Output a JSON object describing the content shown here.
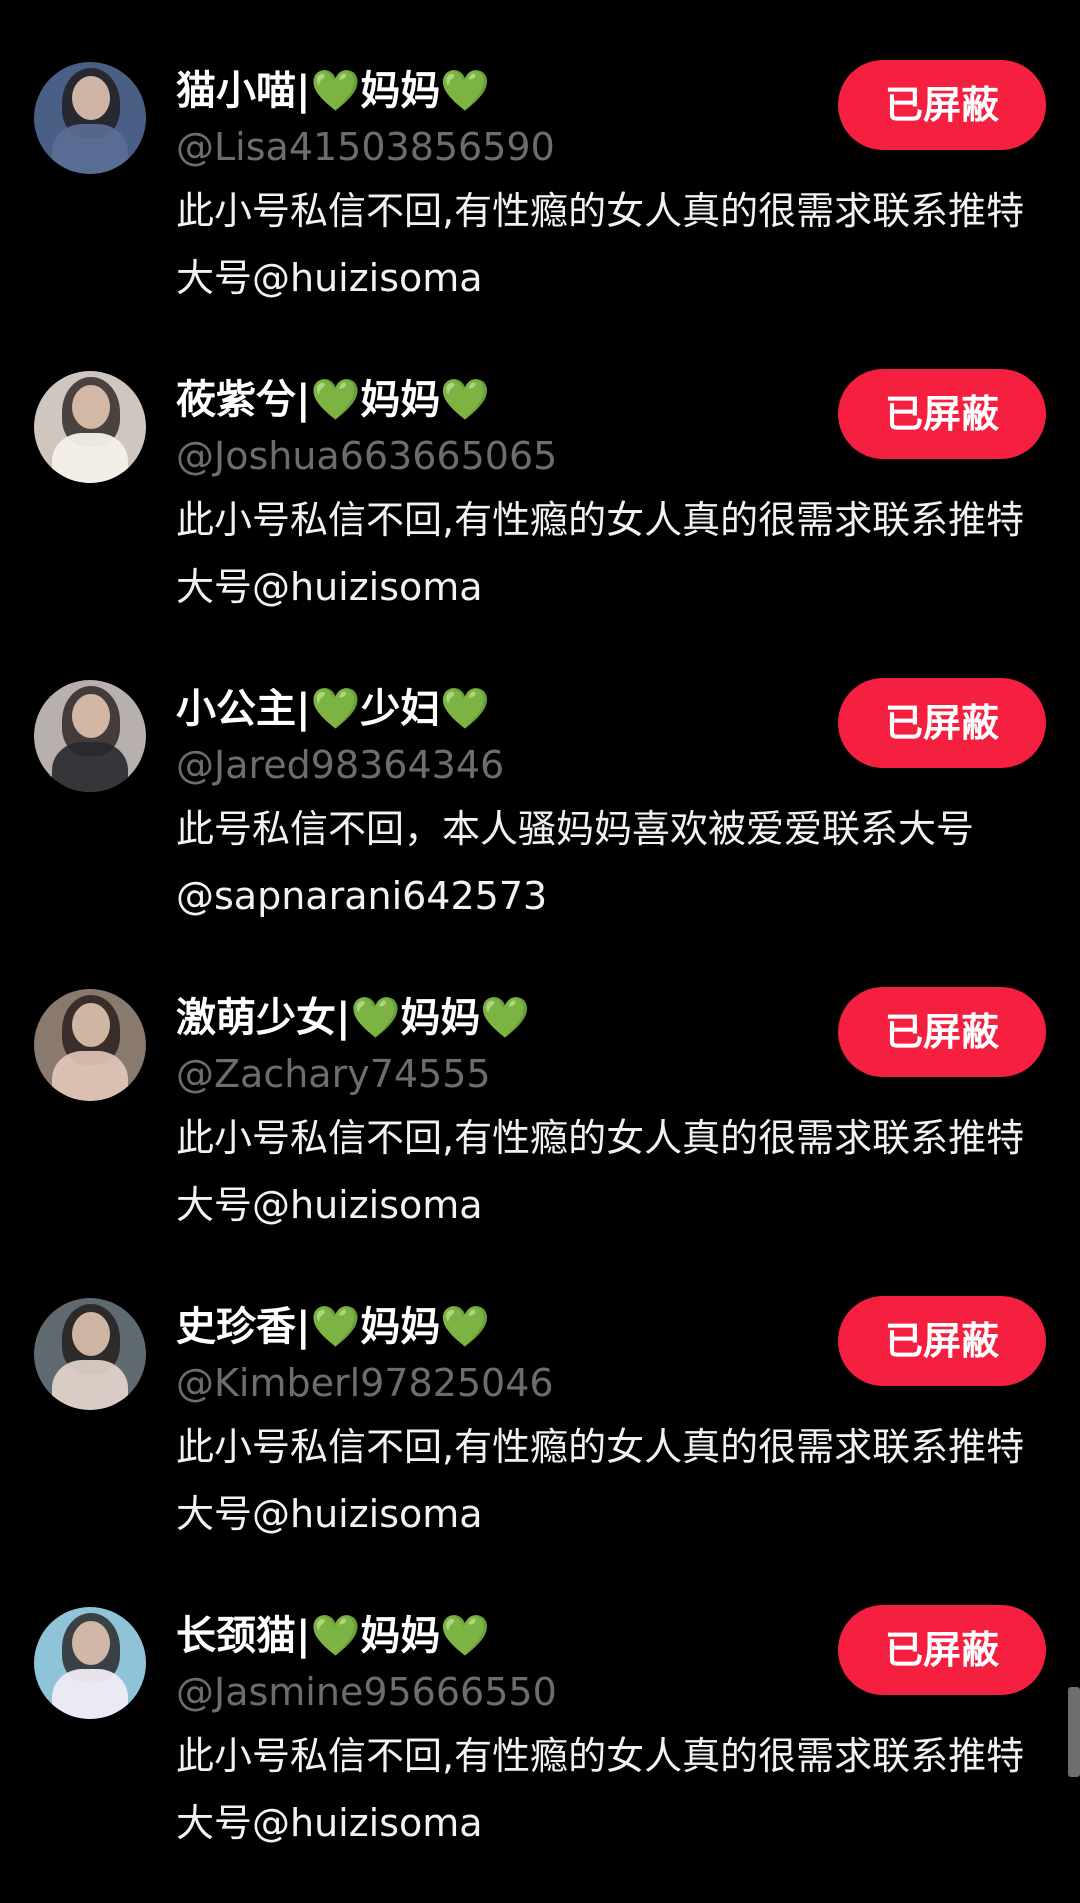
{
  "block_button_label": "已屏蔽",
  "accent_color": "#f5203f",
  "handle_color": "#6d6d6d",
  "users": [
    {
      "name": "猫小喵|💚妈妈💚",
      "handle": "@Lisa41503856590",
      "bio": "此小号私信不回,有性瘾的女人真的很需求联系推特大号@huizisoma"
    },
    {
      "name": "莜紫兮|💚妈妈💚",
      "handle": "@Joshua663665065",
      "bio": "此小号私信不回,有性瘾的女人真的很需求联系推特大号@huizisoma"
    },
    {
      "name": "小公主|💚少妇💚",
      "handle": "@Jared98364346",
      "bio": "此号私信不回，本人骚妈妈喜欢被爱爱联系大号@sapnarani642573"
    },
    {
      "name": "激萌少女|💚妈妈💚",
      "handle": "@Zachary74555",
      "bio": "此小号私信不回,有性瘾的女人真的很需求联系推特大号@huizisoma"
    },
    {
      "name": "史珍香|💚妈妈💚",
      "handle": "@Kimberl97825046",
      "bio": "此小号私信不回,有性瘾的女人真的很需求联系推特大号@huizisoma"
    },
    {
      "name": "长颈猫|💚妈妈💚",
      "handle": "@Jasmine95666550",
      "bio": "此小号私信不回,有性瘾的女人真的很需求联系推特大号@huizisoma"
    }
  ]
}
